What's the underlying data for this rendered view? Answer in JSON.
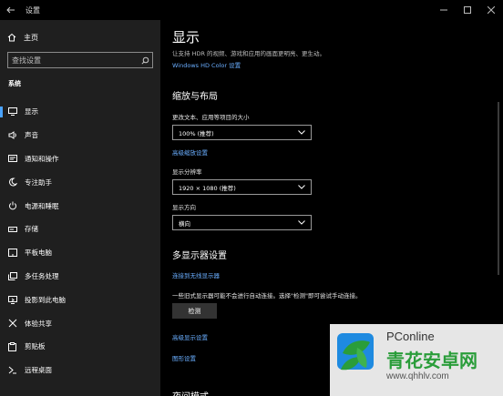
{
  "window": {
    "title": "设置",
    "back_icon": "arrow-left-icon",
    "controls": [
      "minimize-icon",
      "maximize-icon",
      "close-icon"
    ]
  },
  "sidebar": {
    "home_label": "主页",
    "search_placeholder": "查找设置",
    "section_label": "系统",
    "items": [
      {
        "label": "显示",
        "icon": "monitor-icon",
        "active": true
      },
      {
        "label": "声音",
        "icon": "speaker-icon"
      },
      {
        "label": "通知和操作",
        "icon": "notification-icon"
      },
      {
        "label": "专注助手",
        "icon": "moon-icon"
      },
      {
        "label": "电源和睡眠",
        "icon": "power-icon"
      },
      {
        "label": "存储",
        "icon": "storage-icon"
      },
      {
        "label": "平板电脑",
        "icon": "tablet-icon"
      },
      {
        "label": "多任务处理",
        "icon": "multitask-icon"
      },
      {
        "label": "投影到此电脑",
        "icon": "project-icon"
      },
      {
        "label": "体验共享",
        "icon": "share-icon"
      },
      {
        "label": "剪贴板",
        "icon": "clipboard-icon"
      },
      {
        "label": "远程桌面",
        "icon": "remote-desktop-icon"
      }
    ]
  },
  "main": {
    "title": "显示",
    "description": "让支持 HDR 的视频、游戏和应用的画面更明亮、更生动。",
    "hdr_link": "Windows HD Color 设置",
    "scale_heading": "缩放与布局",
    "text_size_label": "更改文本、应用等项目的大小",
    "text_size_value": "100% (推荐)",
    "advanced_scale_link": "高级缩放设置",
    "resolution_label": "显示分辨率",
    "resolution_value": "1920 × 1080 (推荐)",
    "orientation_label": "显示方向",
    "orientation_value": "横向",
    "multi_heading": "多显示器设置",
    "wireless_link": "连接到无线显示器",
    "detect_desc": "一些旧式显示器可能不会进行自动连接。选择\"检测\"即可尝试手动连接。",
    "detect_button": "检测",
    "advanced_display_link": "高级显示设置",
    "graphics_link": "图形设置",
    "bottom_heading_partial": "夜间模式"
  },
  "watermark": {
    "brand": "PConline",
    "site_name": "青花安卓网",
    "url": "www.qhhlv.com",
    "accent": "#2a9d3a"
  },
  "colors": {
    "sidebar_bg": "#1f1f1f",
    "main_bg": "#000000",
    "accent": "#4aa3ff",
    "link": "#6aaeff"
  }
}
